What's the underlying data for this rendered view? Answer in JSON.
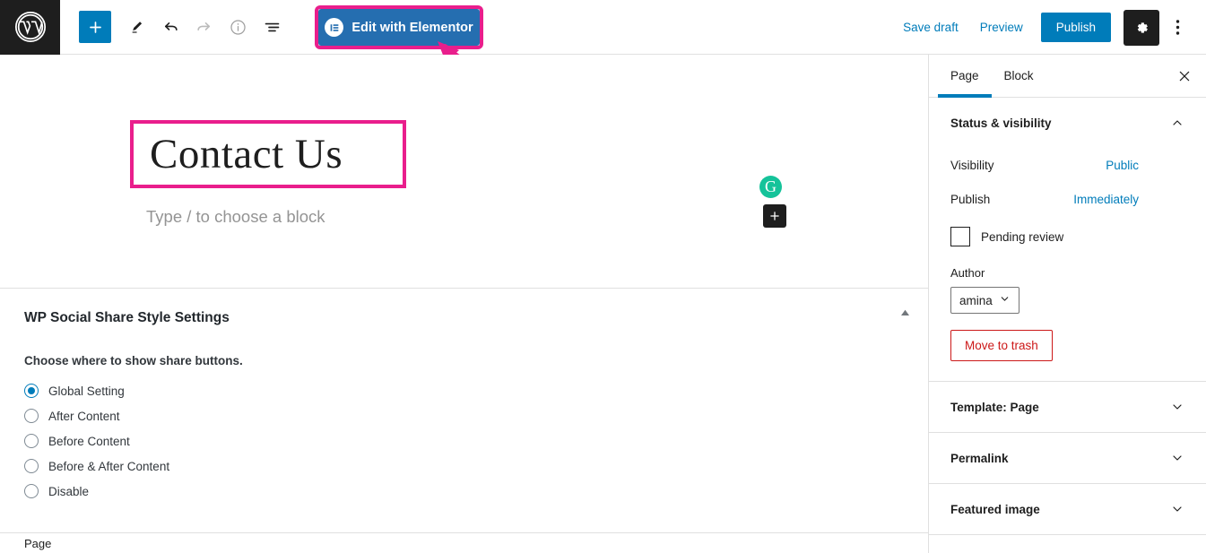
{
  "toolbar": {
    "logo_icon": "wordpress-logo-icon",
    "inserter_label": "+",
    "tools_icon": "pencil-icon",
    "undo_icon": "undo-icon",
    "redo_icon": "redo-icon",
    "info_icon": "info-circle-icon",
    "list_view_icon": "list-view-icon",
    "elementor_label": "Edit with Elementor",
    "elementor_icon": "elementor-logo-icon",
    "save_draft_label": "Save draft",
    "preview_label": "Preview",
    "publish_label": "Publish",
    "settings_icon": "gear-icon",
    "options_icon": "more-vertical-icon",
    "accent_blue": "#007cba",
    "elementor_blue": "#256eb0",
    "annotation_pink": "#e91e8c"
  },
  "canvas": {
    "post_title": "Contact Us",
    "block_placeholder": "Type / to choose a block",
    "grammarly_icon": "grammarly-icon",
    "grammarly_glyph": "G",
    "inserter_icon": "plus-icon",
    "inserter_label": "+"
  },
  "meta_panel": {
    "title": "WP Social Share Style Settings",
    "collapse_icon": "triangle-up-icon",
    "field_label": "Choose where to show share buttons.",
    "options": [
      {
        "label": "Global Setting",
        "selected": true
      },
      {
        "label": "After Content",
        "selected": false
      },
      {
        "label": "Before Content",
        "selected": false
      },
      {
        "label": "Before & After Content",
        "selected": false
      },
      {
        "label": "Disable",
        "selected": false
      }
    ]
  },
  "statusbar": {
    "label": "Page"
  },
  "sidebar": {
    "tabs": [
      {
        "label": "Page",
        "active": true
      },
      {
        "label": "Block",
        "active": false
      }
    ],
    "close_icon": "close-icon",
    "status_section": {
      "title": "Status & visibility",
      "chevron_icon": "chevron-up-icon",
      "visibility_label": "Visibility",
      "visibility_value": "Public",
      "publish_label": "Publish",
      "publish_value": "Immediately",
      "pending_review_label": "Pending review",
      "pending_review_checked": false,
      "author_label": "Author",
      "author_value": "amina",
      "author_chevron_icon": "chevron-down-icon",
      "trash_label": "Move to trash",
      "trash_color": "#cc1818"
    },
    "sections": [
      {
        "title": "Template: Page",
        "chevron_icon": "chevron-down-icon"
      },
      {
        "title": "Permalink",
        "chevron_icon": "chevron-down-icon"
      },
      {
        "title": "Featured image",
        "chevron_icon": "chevron-down-icon"
      }
    ]
  }
}
